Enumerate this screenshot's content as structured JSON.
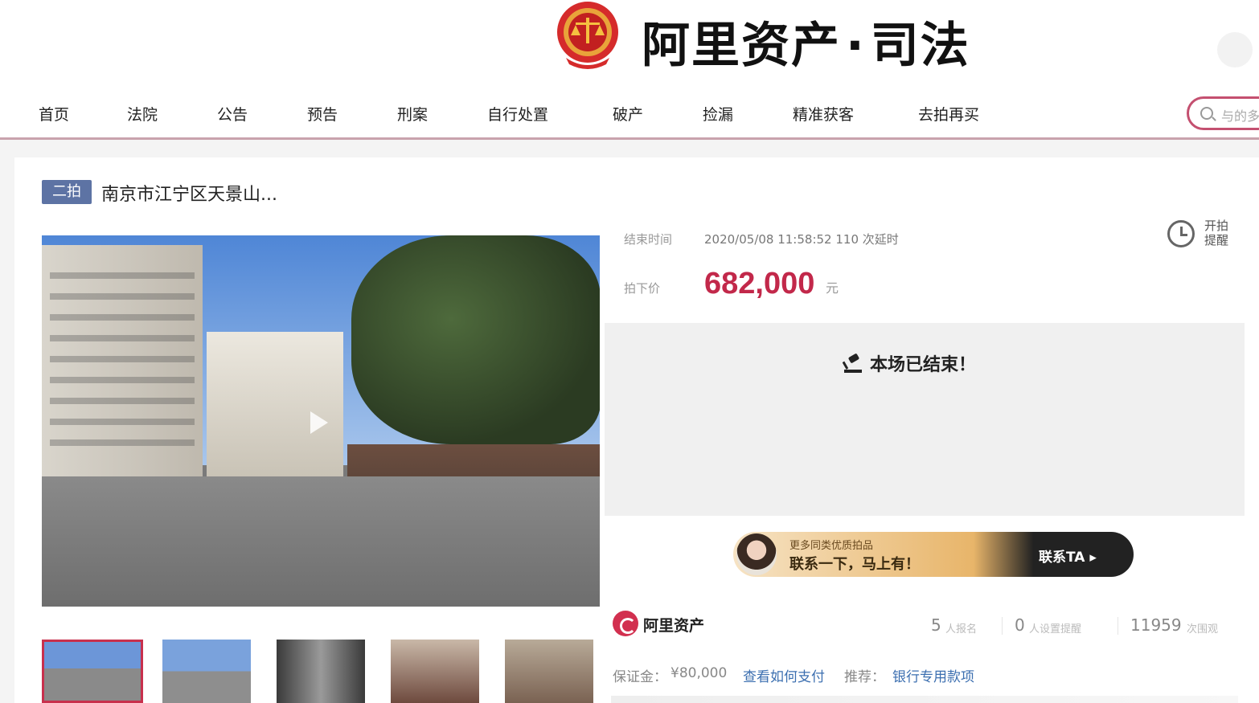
{
  "brand": {
    "title": "阿里资产",
    "dot": "·",
    "subtitle": "司法"
  },
  "nav": {
    "items": [
      "首页",
      "法院",
      "公告",
      "预告",
      "刑案",
      "自行处置",
      "破产",
      "捡漏",
      "精准获客",
      "去拍再买"
    ],
    "search_placeholder": "与的多"
  },
  "listing": {
    "round_badge": "二拍",
    "title": "南京市江宁区天景山...",
    "end_time_label": "结束时间",
    "end_time_value": "2020/05/08 11:58:52  110 次延时",
    "remind_label": "开拍提醒",
    "price_label": "拍下价",
    "price": "682,000",
    "price_unit": "元",
    "ended_text": "本场已结束！"
  },
  "banner": {
    "line1": "更多同类优质拍品",
    "line2": "联系一下，马上有！",
    "cta": "联系TA ▸"
  },
  "stats": {
    "platform": "阿里资产",
    "applicants": "5",
    "applicants_label": "人报名",
    "reminders": "0",
    "reminders_label": "人设置提醒",
    "views": "11959",
    "views_label": "次围观"
  },
  "deposit": {
    "label": "保证金：",
    "value": "¥80,000",
    "link": "查看如何支付",
    "recommend_label": "推荐：",
    "recommend_link": "银行专用款项"
  },
  "colors": {
    "accent": "#c2284a",
    "badge": "#5d73a4",
    "search_border": "#c45070"
  },
  "icons": [
    "court-emblem-icon",
    "search-icon",
    "play-icon",
    "clock-icon",
    "gavel-icon",
    "ali-asset-logo-icon"
  ]
}
